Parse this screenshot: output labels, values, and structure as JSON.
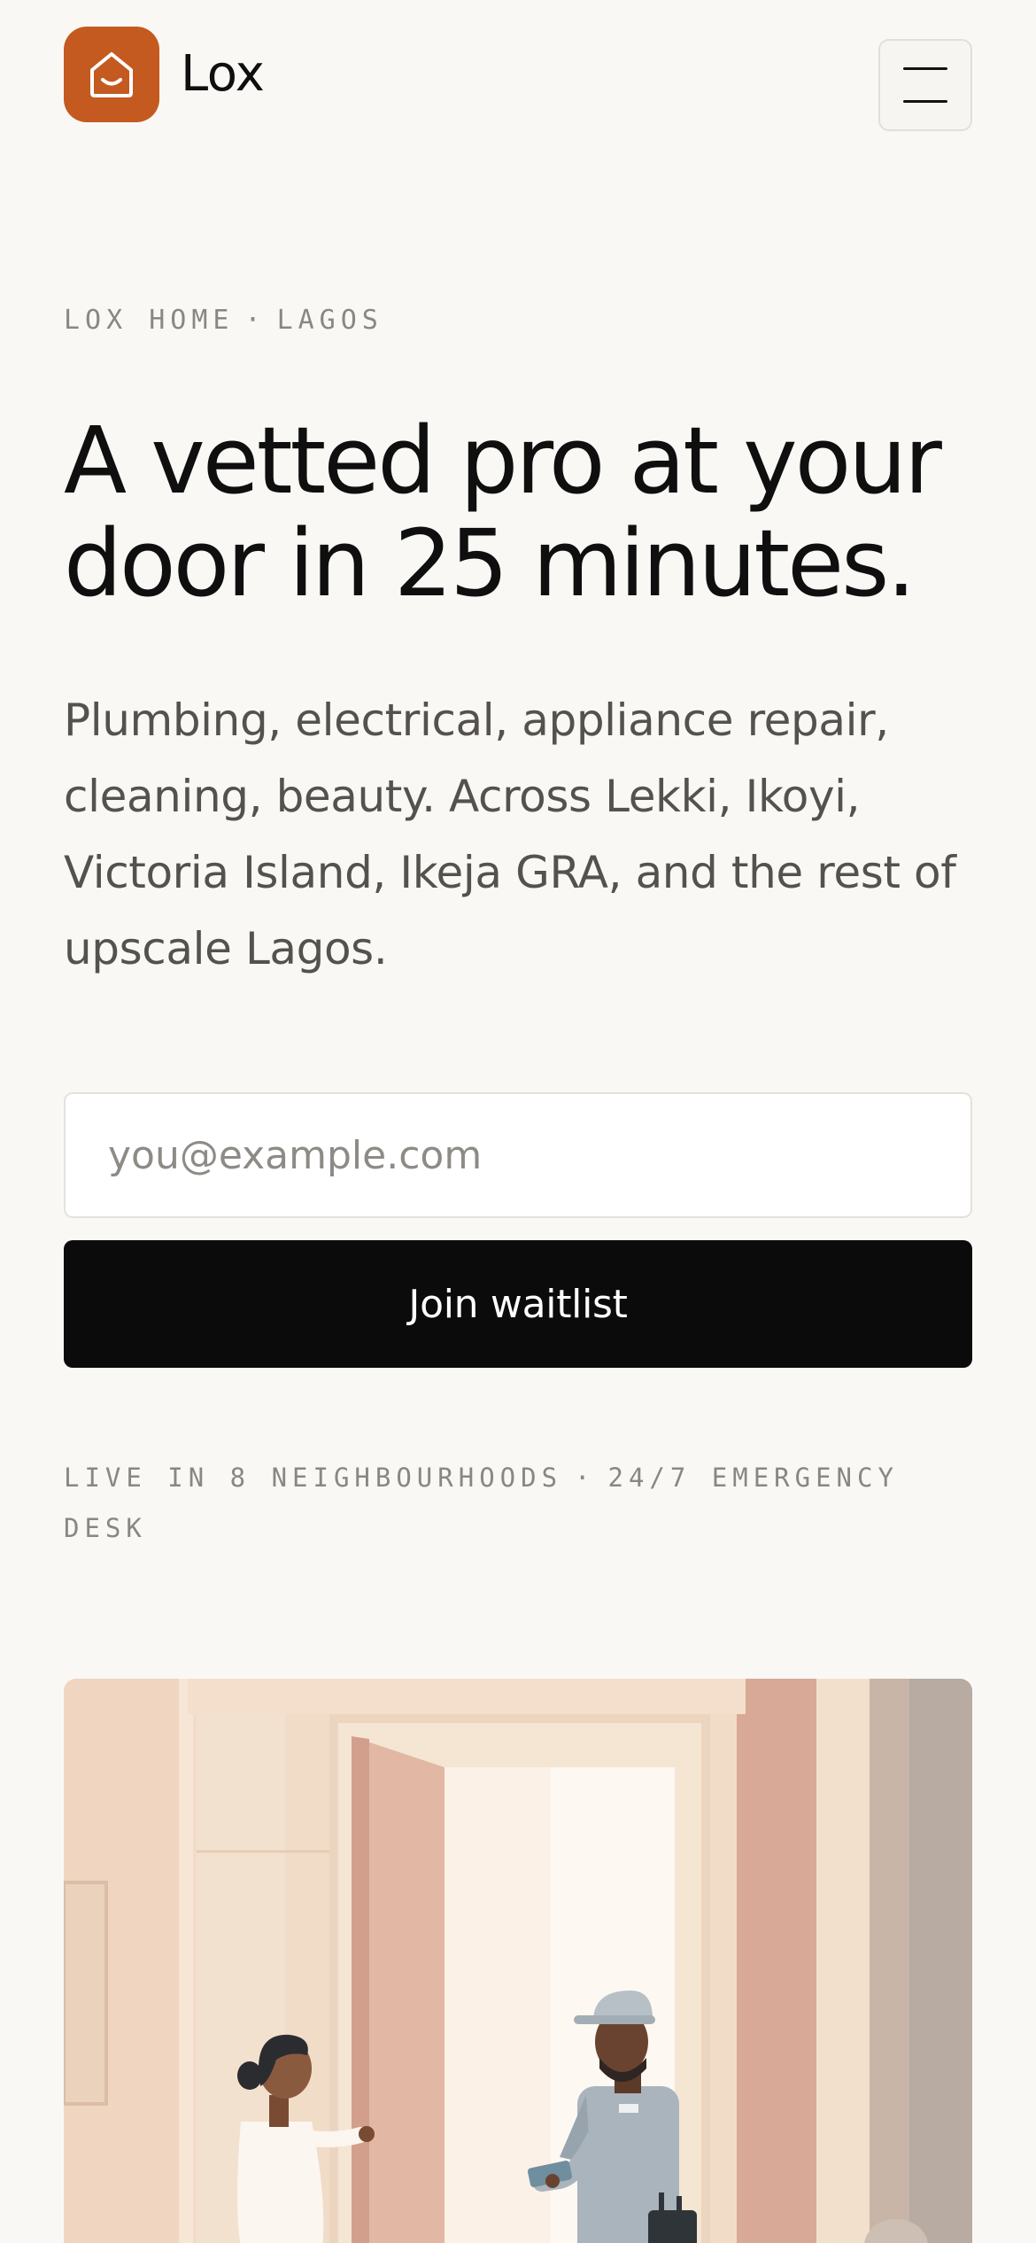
{
  "brand": {
    "name": "Lox",
    "logo_icon": "smiling-house-icon",
    "accent_color": "#c45a1f"
  },
  "header": {
    "menu_icon": "hamburger-menu-icon"
  },
  "hero": {
    "eyebrow_left": "LOX HOME",
    "eyebrow_separator": "·",
    "eyebrow_right": "LAGOS",
    "headline": "A vetted pro at your door in 25 minutes.",
    "subtitle": "Plumbing, electrical, appliance repair, cleaning, beauty. Across Lekki, Ikoyi, Victoria Island, Ikeja GRA, and the rest of upscale Lagos."
  },
  "waitlist": {
    "email_placeholder": "you@example.com",
    "email_value": "",
    "button_label": "Join waitlist"
  },
  "footnote": {
    "left": "LIVE IN 8 NEIGHBOURHOODS",
    "separator": "·",
    "right": "24/7 EMERGENCY DESK"
  },
  "illustration": {
    "subject": "doorway-illustration",
    "palette": [
      "#f3dcc6",
      "#e9c8b2",
      "#d9a995",
      "#b8b3ad",
      "#fdf7f0"
    ]
  }
}
